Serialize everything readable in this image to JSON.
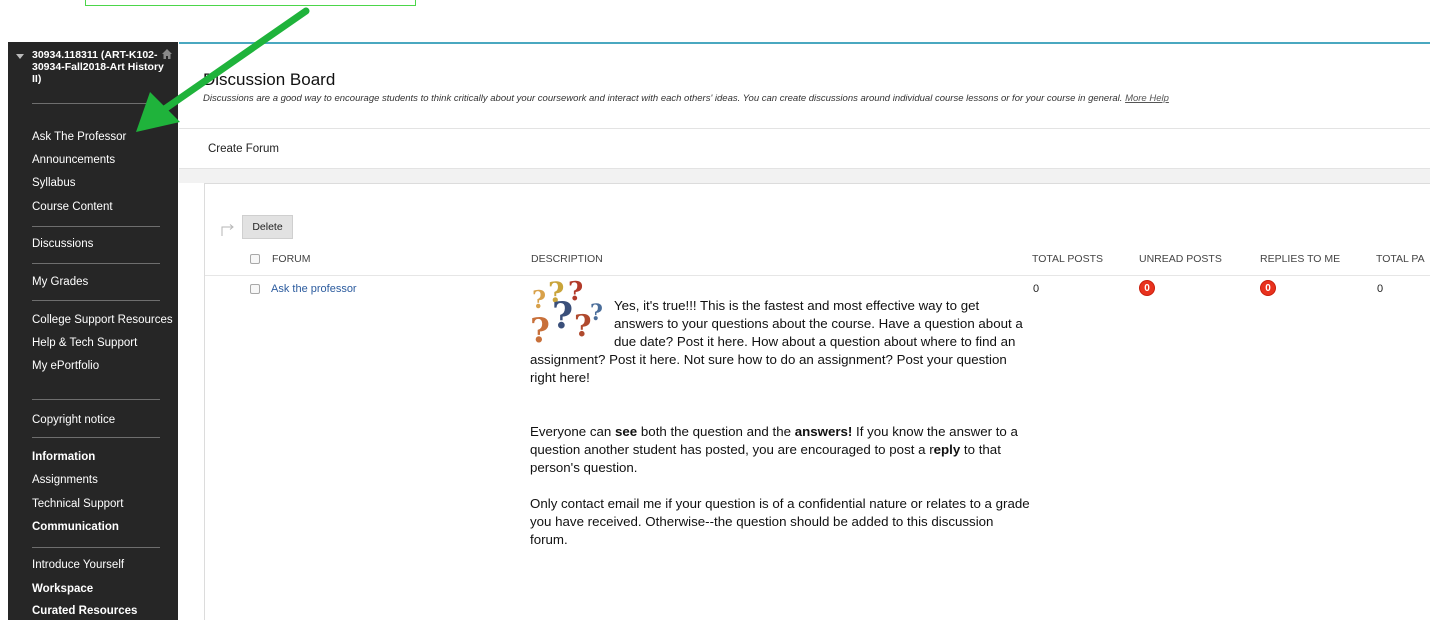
{
  "sidebar": {
    "course_title": "30934.118311 (ART-K102-30934-Fall2018-Art History II)",
    "items": [
      {
        "label": "Ask The Professor"
      },
      {
        "label": "Announcements"
      },
      {
        "label": "Syllabus"
      },
      {
        "label": "Course Content"
      },
      {
        "label": "Discussions"
      },
      {
        "label": "My Grades"
      },
      {
        "label": "College Support Resources"
      },
      {
        "label": "Help & Tech Support"
      },
      {
        "label": "My ePortfolio"
      },
      {
        "label": "Copyright notice"
      },
      {
        "label": "Information"
      },
      {
        "label": "Assignments"
      },
      {
        "label": "Technical Support"
      },
      {
        "label": "Communication"
      },
      {
        "label": "Introduce Yourself"
      },
      {
        "label": "Workspace"
      },
      {
        "label": "Curated Resources"
      }
    ]
  },
  "page": {
    "title": "Discussion Board",
    "description": "Discussions are a good way to encourage students to think critically about your coursework and interact with each others' ideas. You can create discussions around individual course lessons or for your course in general.",
    "more_help": "More Help"
  },
  "toolbar": {
    "create_forum": "Create Forum",
    "delete_label": "Delete"
  },
  "table": {
    "headers": {
      "forum": "FORUM",
      "description": "DESCRIPTION",
      "total_posts": "TOTAL POSTS",
      "unread_posts": "UNREAD POSTS",
      "replies_to_me": "REPLIES TO ME",
      "total_participants": "TOTAL PA"
    },
    "rows": [
      {
        "forum": "Ask the professor",
        "total_posts": "0",
        "unread_posts": "0",
        "replies_to_me": "0",
        "total_participants": "0",
        "description": {
          "p1": "Yes, it's true!!! This is the fastest and most effective way to get answers to your questions about the course. Have a question about a due date? Post it here. How about a question about where to find an assignment? Post it here. Not sure how to do an assignment? Post your question right here!",
          "p2_a": "Everyone can ",
          "p2_see": "see",
          "p2_b": " both the question and the ",
          "p2_answers": "answers!",
          "p2_c": " If you know the answer to a question another student has posted, you are encouraged to post a r",
          "p2_eply": "eply",
          "p2_d": " to that person's question.",
          "p3": "Only contact email me  if your question is of a confidential nature or relates to a grade you have received. Otherwise--the question should be added to this discussion forum."
        }
      }
    ]
  },
  "colors": {
    "sidebar_bg": "#262626",
    "accent_link": "#2b5b9e",
    "badge_red": "#e8321e",
    "annotation_arrow": "#1fb33b",
    "top_rule": "#4aa8c0"
  }
}
